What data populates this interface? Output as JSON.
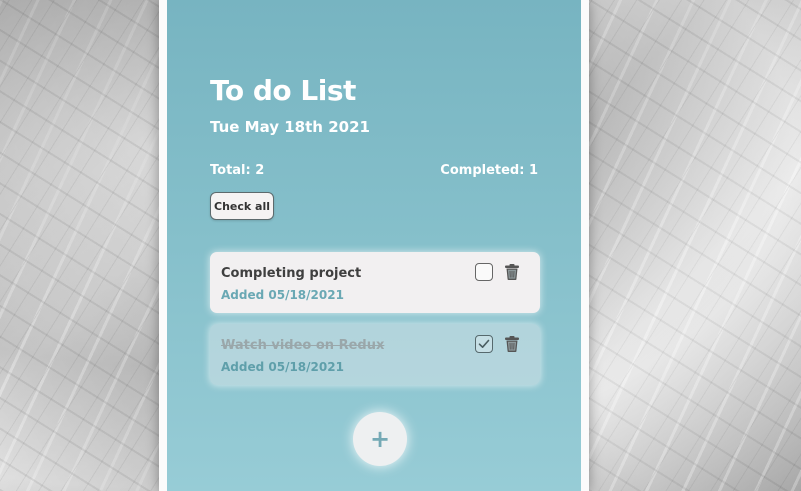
{
  "app": {
    "title": "To do List",
    "date": "Tue May 18th 2021"
  },
  "stats": {
    "total": "Total: 2",
    "completed": "Completed: 1"
  },
  "actions": {
    "check_all_label": "Check all",
    "add_label": "+"
  },
  "todos": [
    {
      "text": "Completing project",
      "added": "Added 05/18/2021",
      "completed": false,
      "checkbox_icon": "checkbox-empty",
      "delete_icon": "trash-icon"
    },
    {
      "text": "Watch video on Redux",
      "added": "Added 05/18/2021",
      "completed": true,
      "checkbox_icon": "checkbox-checked",
      "delete_icon": "trash-icon"
    }
  ],
  "colors": {
    "panel_gradient_top": "#77b4c1",
    "panel_gradient_bottom": "#97ccd6",
    "accent": "#6aa8b4",
    "card_background": "#f2f0f1"
  }
}
